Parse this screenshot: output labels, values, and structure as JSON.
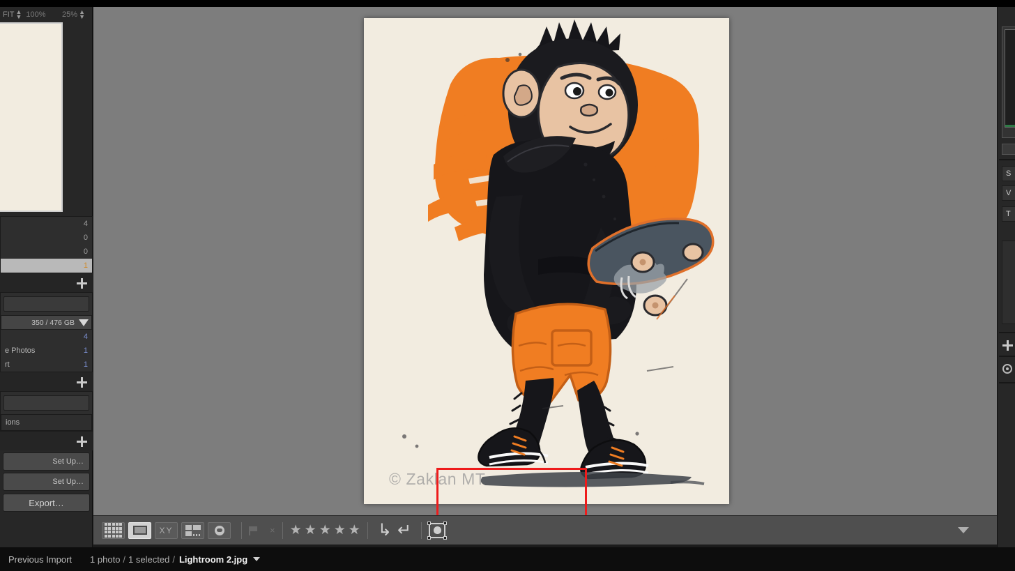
{
  "app": {
    "module": "Library",
    "background_color": "#7d7d7d",
    "panel_color": "#272727"
  },
  "navigator": {
    "fit_label": "FIT",
    "zoom_100_label": "100%",
    "zoom_25_label": "25%",
    "stepper_glyph": "⇵"
  },
  "left_panel": {
    "catalog_rows": [
      {
        "label": "",
        "count": "4",
        "selected": false
      },
      {
        "label": "",
        "count": "0",
        "selected": false
      },
      {
        "label": "",
        "count": "0",
        "selected": false
      },
      {
        "label": "",
        "count": "1",
        "selected": true
      }
    ],
    "folder_rows": [
      {
        "label": "",
        "count": "4"
      },
      {
        "label": "e Photos",
        "count": "1"
      },
      {
        "label": "rt",
        "count": "1"
      }
    ],
    "disk_space": "350 / 476 GB",
    "collections_label": "ions",
    "setup_button": "Set Up…",
    "setup_button_2": "Set Up…",
    "export_button": "Export…",
    "plus_icon": "plus-icon"
  },
  "right_panel": {
    "sections": [
      {
        "label": "S"
      },
      {
        "label": "V"
      },
      {
        "label": "T"
      }
    ],
    "plus_icon": "plus-icon",
    "gear_icon": "gear-icon"
  },
  "photo": {
    "filename": "Lightroom 2.jpg",
    "watermark_text": "© Zaklan MT",
    "paper_color": "#f2ece0",
    "accent_orange": "#f07d22",
    "ink_black": "#1c1c1c",
    "skin_tan": "#e8c3a3",
    "board_gray": "#4a5560",
    "subject": "cartoon chimpanzee skateboarder"
  },
  "annotation": {
    "shape": "rectangle",
    "color": "#ee1b1b",
    "targets": "watermark-region"
  },
  "toolbar": {
    "view_modes": [
      {
        "name": "grid-view",
        "label": "Grid",
        "active": false
      },
      {
        "name": "loupe-view",
        "label": "Loupe",
        "active": true
      },
      {
        "name": "compare-view",
        "label": "XY",
        "active": false
      },
      {
        "name": "survey-view",
        "label": "Survey",
        "active": false
      },
      {
        "name": "people-view",
        "label": "People",
        "active": false
      }
    ],
    "flag_label": "Flag",
    "reject_label": "×",
    "star_glyph": "★",
    "star_count": 5,
    "rotate_right": "↳",
    "rotate_left": "↵",
    "crop_label": "Crop",
    "chevron_icon": "chevron-down-icon"
  },
  "status": {
    "source": "Previous Import",
    "photo_count": "1 photo",
    "selected": "1 selected",
    "filename": "Lightroom 2.jpg",
    "separator": "/",
    "caret_icon": "caret-down-icon"
  }
}
